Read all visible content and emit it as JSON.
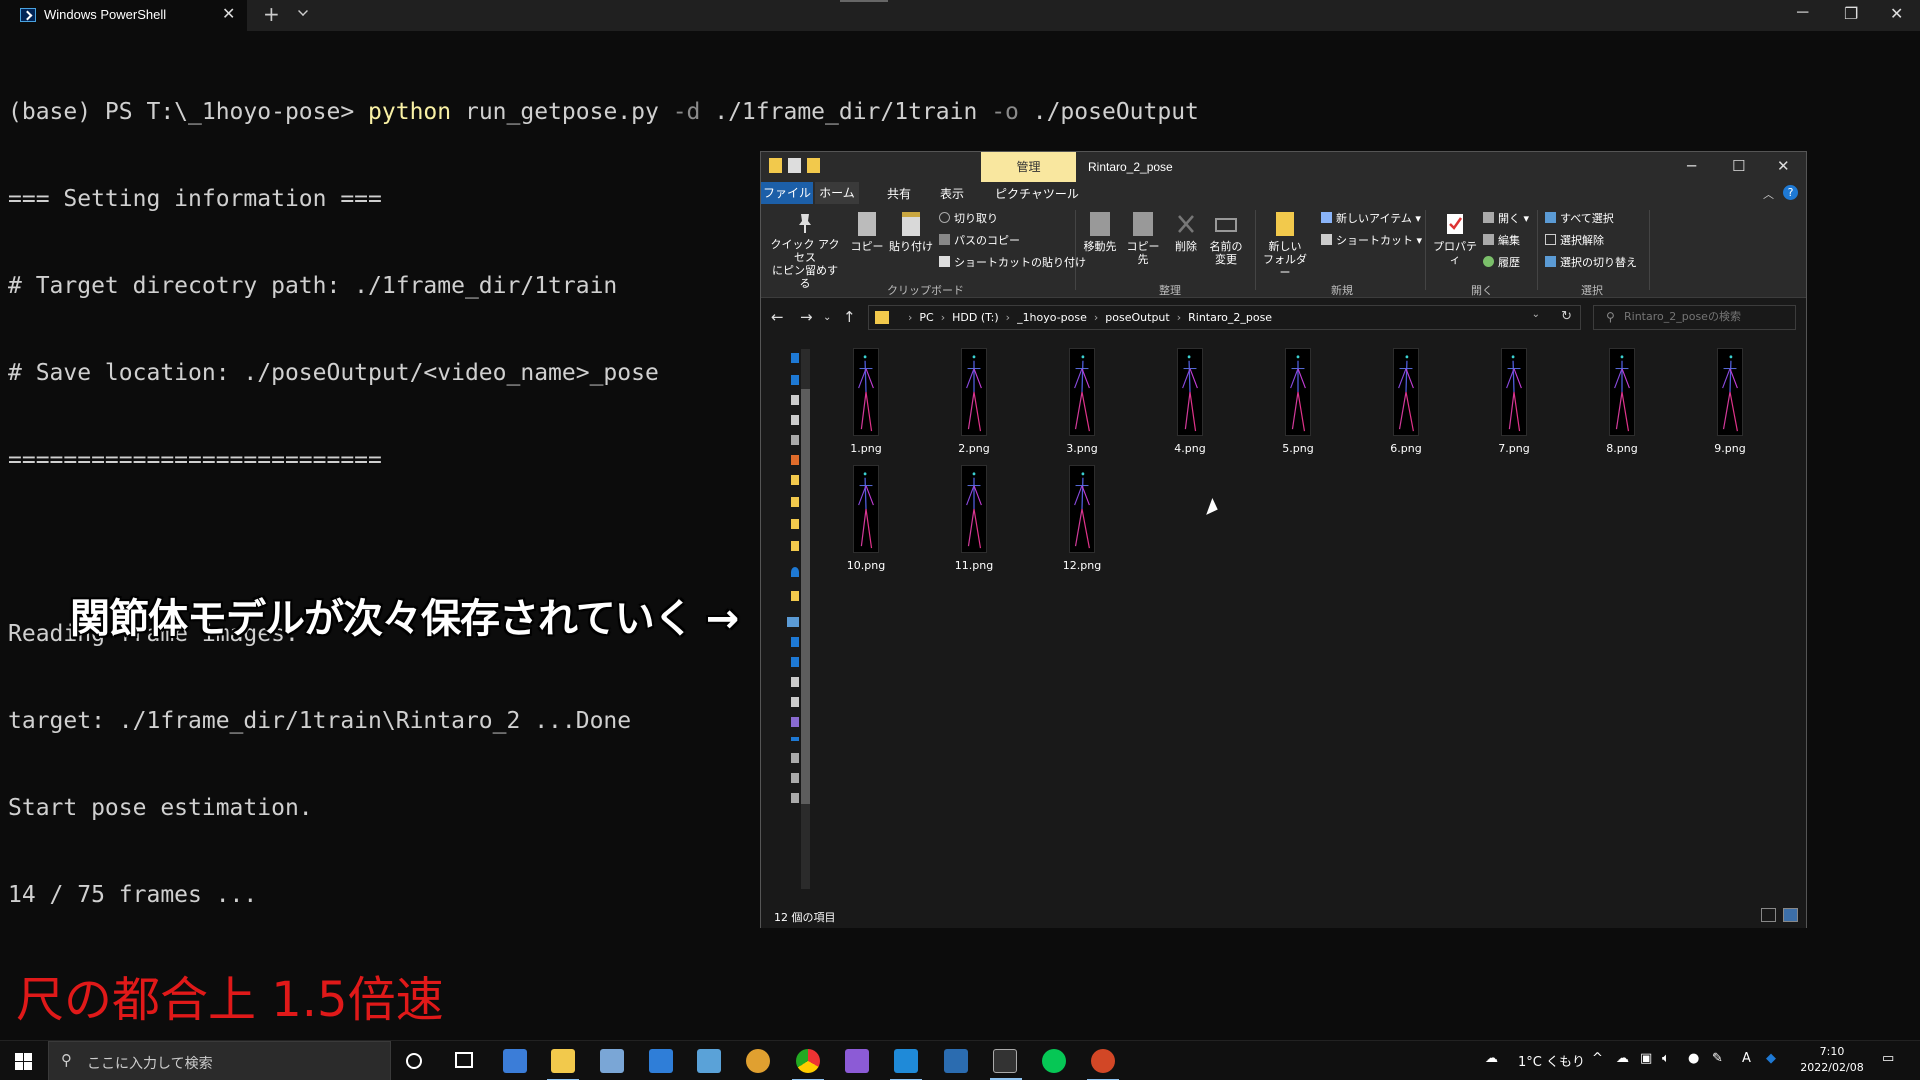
{
  "terminal": {
    "tab_title": "Windows PowerShell",
    "tab_close": "✕",
    "new_tab": "+",
    "window_controls": {
      "minimize": "─",
      "maximize": "❐",
      "close": "✕"
    },
    "line1_prompt": "(base) PS T:\\_1hoyo-pose> ",
    "line1_cmd": "python",
    "line1_script": " run_getpose.py ",
    "line1_flag_d": "-d",
    "line1_arg_d": " ./1frame_dir/1train ",
    "line1_flag_o": "-o",
    "line1_arg_o": " ./poseOutput",
    "lines": [
      "=== Setting information ===",
      "# Target direcotry path: ./1frame_dir/1train",
      "# Save location: ./poseOutput/<video_name>_pose",
      "===========================",
      "",
      "Reading frame images.",
      "target: ./1frame_dir/1train\\Rintaro_2 ...Done",
      "Start pose estimation.",
      "14 / 75 frames ..."
    ]
  },
  "overlay": {
    "caption": "関節体モデルが次々保存されていく →",
    "speed_note": "尺の都合上 1.5倍速"
  },
  "explorer": {
    "manage_tab": "管理",
    "title": "Rintaro_2_pose",
    "window_controls": {
      "minimize": "─",
      "maximize": "☐",
      "close": "✕"
    },
    "ribbon_tabs": [
      "ファイル",
      "ホーム",
      "共有",
      "表示",
      "ピクチャツール"
    ],
    "help": "?",
    "ribbon": {
      "pin_label_1": "クイック アクセス",
      "pin_label_2": "にピン留めする",
      "copy": "コピー",
      "paste": "貼り付け",
      "cut": "切り取り",
      "copy_path": "パスのコピー",
      "paste_shortcut": "ショートカットの貼り付け",
      "group_clipboard": "クリップボード",
      "move_to": "移動先",
      "copy_to": "コピー先",
      "delete": "削除",
      "rename_1": "名前の",
      "rename_2": "変更",
      "group_organize": "整理",
      "new_folder_1": "新しい",
      "new_folder_2": "フォルダー",
      "new_item": "新しいアイテム ▾",
      "shortcut": "ショートカット ▾",
      "group_new": "新規",
      "properties": "プロパティ",
      "open": "開く ▾",
      "edit": "編集",
      "history": "履歴",
      "group_open": "開く",
      "select_all": "すべて選択",
      "select_none": "選択解除",
      "invert_selection": "選択の切り替え",
      "group_select": "選択"
    },
    "address": {
      "crumbs": [
        "PC",
        "HDD (T:)",
        "_1hoyo-pose",
        "poseOutput",
        "Rintaro_2_pose"
      ]
    },
    "search_placeholder": "Rintaro_2_poseの検索",
    "files": [
      "1.png",
      "2.png",
      "3.png",
      "4.png",
      "5.png",
      "6.png",
      "7.png",
      "8.png",
      "9.png",
      "10.png",
      "11.png",
      "12.png"
    ],
    "status_count": "12 個の項目"
  },
  "taskbar": {
    "search_placeholder": "ここに入力して検索",
    "weather": "1°C くもり",
    "ime": "A",
    "time": "7:10",
    "date": "2022/02/08"
  },
  "colors": {
    "terminal_bg": "#0c0c0c",
    "command_yellow": "#f9f1a5",
    "caption_red": "#e01919",
    "manage_tab_bg": "#f9e79f",
    "file_tab_blue": "#1c5fa8"
  }
}
